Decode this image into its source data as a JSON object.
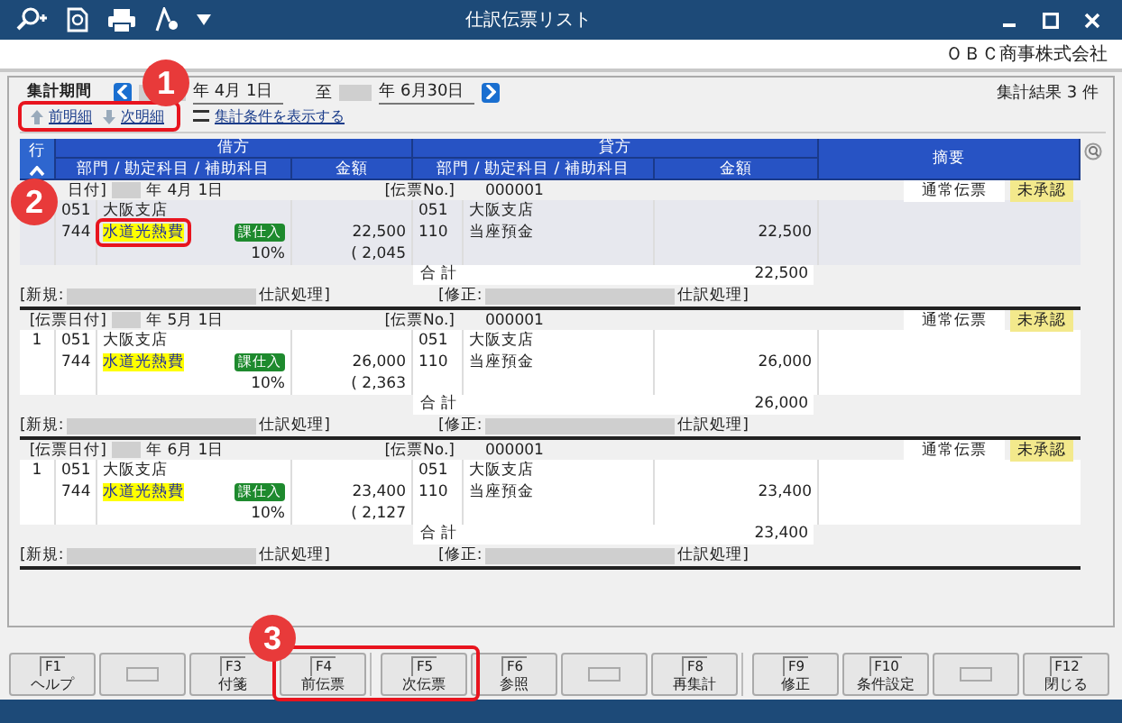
{
  "window": {
    "title": "仕訳伝票リスト"
  },
  "company": "ＯＢＣ商事株式会社",
  "period": {
    "label": "集計期間",
    "from": "年  4月 1日",
    "to_label": "至",
    "to": "年  6月30日"
  },
  "result": "集計結果 3 件",
  "links": [
    {
      "label": "前明細",
      "kind": "up"
    },
    {
      "label": "次明細",
      "kind": "down"
    },
    {
      "label": "集計条件を表示する",
      "kind": "conditions"
    }
  ],
  "table": {
    "row_header": "行",
    "debit": "借方",
    "credit": "貸方",
    "summary": "摘要",
    "account_header": "部門 / 勘定科目 / 補助科目",
    "amount_header": "金額",
    "credit_account_header": "部門 / 勘定科目 / 補助科目",
    "credit_amount_header": "金額"
  },
  "vouchers": [
    {
      "selected": true,
      "date_label": "日付]",
      "date": "年  4月  1日",
      "no_label": "[伝票No.]",
      "no": "000001",
      "type": "通常伝票",
      "status": "未承認",
      "debit": {
        "dept_code": "051",
        "dept": "大阪支店",
        "account_code": "744",
        "account": "水道光熱費",
        "tax_tag": "課仕入",
        "tax_rate": "10%",
        "amount": "22,500",
        "tax": "( 2,045"
      },
      "credit": {
        "dept_code": "051",
        "dept": "大阪支店",
        "account_code": "110",
        "account": "当座預金",
        "amount": "22,500"
      },
      "total_label": "合  計",
      "total": "22,500",
      "new_label": "[新規:",
      "new_suffix": "仕訳処理]",
      "mod_label": "[修正:",
      "mod_suffix": "仕訳処理]"
    },
    {
      "selected": false,
      "line": "1",
      "date_label": "[伝票日付]",
      "date": "年  5月  1日",
      "no_label": "[伝票No.]",
      "no": "000001",
      "type": "通常伝票",
      "status": "未承認",
      "debit": {
        "dept_code": "051",
        "dept": "大阪支店",
        "account_code": "744",
        "account": "水道光熱費",
        "tax_tag": "課仕入",
        "tax_rate": "10%",
        "amount": "26,000",
        "tax": "( 2,363"
      },
      "credit": {
        "dept_code": "051",
        "dept": "大阪支店",
        "account_code": "110",
        "account": "当座預金",
        "amount": "26,000"
      },
      "total_label": "合  計",
      "total": "26,000",
      "new_label": "[新規:",
      "new_suffix": "仕訳処理]",
      "mod_label": "[修正:",
      "mod_suffix": "仕訳処理]"
    },
    {
      "selected": false,
      "line": "1",
      "date_label": "[伝票日付]",
      "date": "年  6月  1日",
      "no_label": "[伝票No.]",
      "no": "000001",
      "type": "通常伝票",
      "status": "未承認",
      "debit": {
        "dept_code": "051",
        "dept": "大阪支店",
        "account_code": "744",
        "account": "水道光熱費",
        "tax_tag": "課仕入",
        "tax_rate": "10%",
        "amount": "23,400",
        "tax": "( 2,127"
      },
      "credit": {
        "dept_code": "051",
        "dept": "大阪支店",
        "account_code": "110",
        "account": "当座預金",
        "amount": "23,400"
      },
      "total_label": "合  計",
      "total": "23,400",
      "new_label": "[新規:",
      "new_suffix": "仕訳処理]",
      "mod_label": "[修正:",
      "mod_suffix": "仕訳処理]"
    }
  ],
  "function_keys": [
    {
      "kind": "key",
      "key": "F1",
      "label": "ヘルプ"
    },
    {
      "kind": "empty"
    },
    {
      "kind": "key",
      "key": "F3",
      "label": "付箋"
    },
    {
      "kind": "key",
      "key": "F4",
      "label": "前伝票"
    },
    {
      "kind": "key",
      "key": "F5",
      "label": "次伝票"
    },
    {
      "kind": "key",
      "key": "F6",
      "label": "参照"
    },
    {
      "kind": "empty"
    },
    {
      "kind": "key",
      "key": "F8",
      "label": "再集計"
    },
    {
      "kind": "key",
      "key": "F9",
      "label": "修正"
    },
    {
      "kind": "key",
      "key": "F10",
      "label": "条件設定"
    },
    {
      "kind": "empty"
    },
    {
      "kind": "key",
      "key": "F12",
      "label": "閉じる"
    }
  ],
  "callouts": [
    {
      "number": "1"
    },
    {
      "number": "2"
    },
    {
      "number": "3"
    }
  ]
}
